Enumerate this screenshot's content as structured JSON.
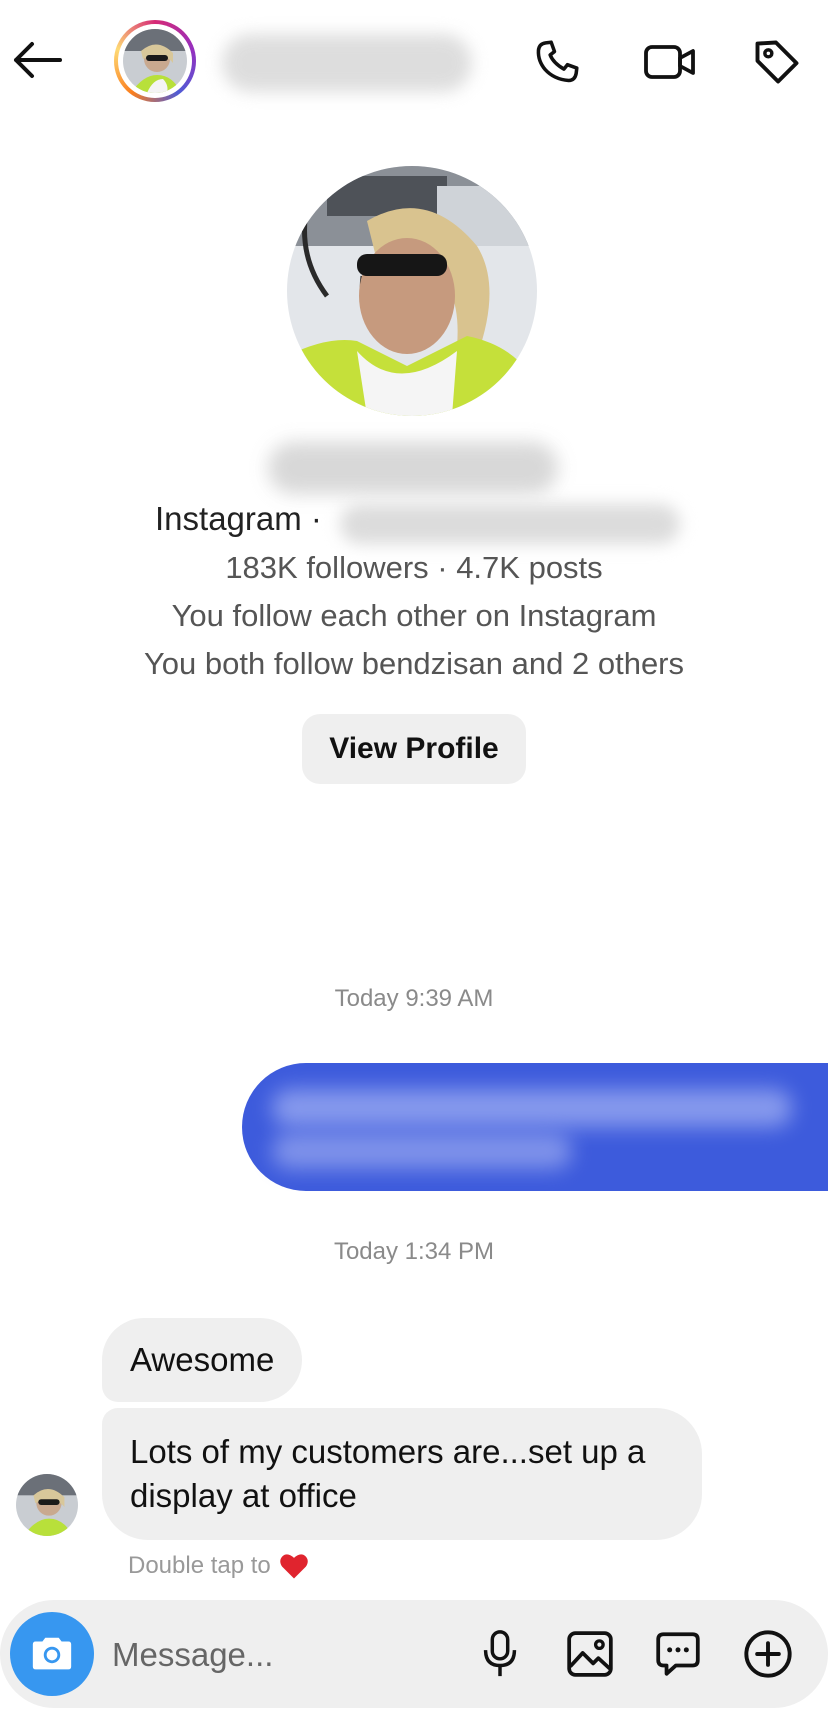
{
  "header": {
    "back_icon": "arrow-left-icon",
    "contact_name": "",
    "call_icon": "phone-icon",
    "video_icon": "video-camera-icon",
    "tag_icon": "tag-icon",
    "story_ring_colors": [
      "#d62976",
      "#962fbf",
      "#4f5bd5",
      "#fa7e1e",
      "#feda75"
    ]
  },
  "profile": {
    "display_name": "",
    "platform_label": "Instagram ·",
    "username": "",
    "stats": "183K followers · 4.7K posts",
    "mutual_follow": "You follow each other on Instagram",
    "mutual_friends": "You both follow bendzisan and 2 others",
    "view_profile_label": "View Profile"
  },
  "conversation": {
    "timestamp_1": "Today 9:39 AM",
    "sent_message": "",
    "timestamp_2": "Today 1:34 PM",
    "received_messages": [
      "Awesome",
      "Lots of my customers  are...set up a display  at office"
    ],
    "reaction_hint": "Double tap to",
    "reaction_icon": "red-heart-icon"
  },
  "composer": {
    "camera_icon": "camera-icon",
    "placeholder": "Message...",
    "mic_icon": "microphone-icon",
    "gallery_icon": "image-icon",
    "sticker_icon": "chat-bubble-icon",
    "plus_icon": "plus-circle-icon"
  },
  "colors": {
    "sent_bubble": "#3d5bdc",
    "received_bubble": "#efefef",
    "camera_button": "#3797f0",
    "heart": "#e0242e"
  }
}
